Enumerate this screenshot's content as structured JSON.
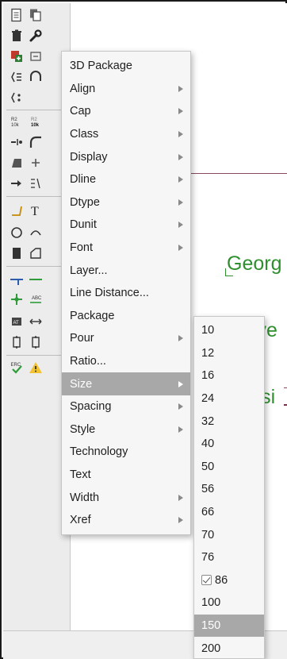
{
  "canvas": {
    "text_lines": [
      "Georg",
      "Unive",
      "Physi"
    ]
  },
  "menu": {
    "items": [
      {
        "label": "3D Package",
        "submenu": false
      },
      {
        "label": "Align",
        "submenu": true
      },
      {
        "label": "Cap",
        "submenu": true
      },
      {
        "label": "Class",
        "submenu": true
      },
      {
        "label": "Display",
        "submenu": true
      },
      {
        "label": "Dline",
        "submenu": true
      },
      {
        "label": "Dtype",
        "submenu": true
      },
      {
        "label": "Dunit",
        "submenu": true
      },
      {
        "label": "Font",
        "submenu": true
      },
      {
        "label": "Layer...",
        "submenu": false
      },
      {
        "label": "Line Distance...",
        "submenu": false
      },
      {
        "label": "Package",
        "submenu": false
      },
      {
        "label": "Pour",
        "submenu": true
      },
      {
        "label": "Ratio...",
        "submenu": false
      },
      {
        "label": "Size",
        "submenu": true,
        "highlighted": true
      },
      {
        "label": "Spacing",
        "submenu": true
      },
      {
        "label": "Style",
        "submenu": true
      },
      {
        "label": "Technology",
        "submenu": false
      },
      {
        "label": "Text",
        "submenu": false
      },
      {
        "label": "Width",
        "submenu": true
      },
      {
        "label": "Xref",
        "submenu": true
      }
    ]
  },
  "size_submenu": {
    "items": [
      {
        "label": "10"
      },
      {
        "label": "12"
      },
      {
        "label": "16"
      },
      {
        "label": "24"
      },
      {
        "label": "32"
      },
      {
        "label": "40"
      },
      {
        "label": "50"
      },
      {
        "label": "56"
      },
      {
        "label": "66"
      },
      {
        "label": "70"
      },
      {
        "label": "76"
      },
      {
        "label": "86",
        "checked": true
      },
      {
        "label": "100"
      },
      {
        "label": "150",
        "highlighted": true
      },
      {
        "label": "200"
      }
    ]
  },
  "toolbar": {
    "icons": [
      "new-document-icon",
      "copy-icon",
      "delete-icon",
      "wrench-icon",
      "add-part-icon",
      "replace-icon",
      "pinswap-icon",
      "gateswap-icon",
      "smash-icon",
      "change-label-icon",
      "value-label-icon",
      "mirror-icon",
      "miter-icon",
      "split-icon",
      "add-icon",
      "move-icon",
      "arrange-icon",
      "wire-icon",
      "text-icon",
      "circle-icon",
      "arc-icon",
      "rect-icon",
      "polygon-icon",
      "net-icon",
      "bus-icon",
      "junction-icon",
      "label-icon",
      "attribute-icon",
      "dimension-icon",
      "frame-icon",
      "frame2-icon",
      "erc-icon",
      "warning-icon"
    ]
  },
  "colors": {
    "menu_highlight": "#a8a8a8",
    "canvas_text": "#2f8f2f",
    "canvas_line": "#8a4a5e"
  }
}
